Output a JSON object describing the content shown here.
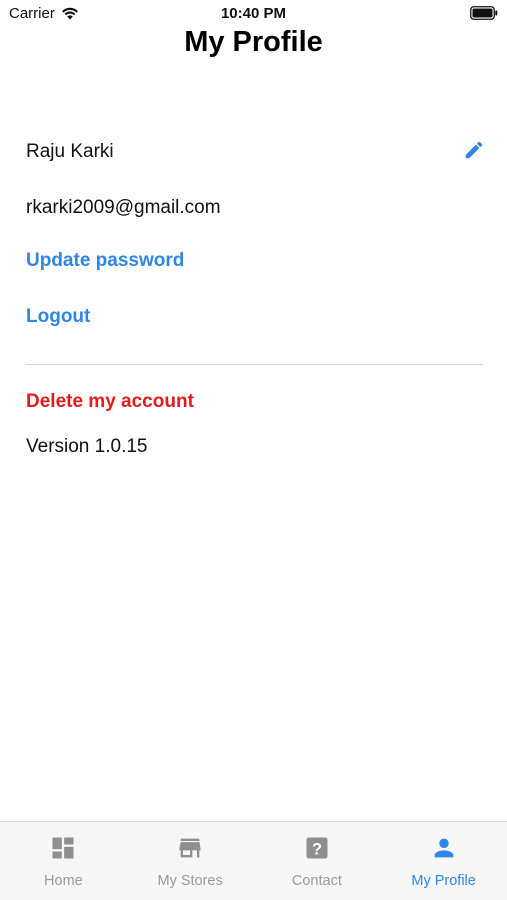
{
  "status_bar": {
    "carrier": "Carrier",
    "time": "10:40 PM"
  },
  "header": {
    "title": "My Profile"
  },
  "profile": {
    "name": "Raju Karki",
    "email": "rkarki2009@gmail.com",
    "update_password_label": "Update password",
    "logout_label": "Logout",
    "delete_account_label": "Delete my account",
    "version_text": "Version 1.0.15"
  },
  "tab_bar": {
    "tabs": [
      {
        "label": "Home",
        "icon": "dashboard-icon",
        "active": false
      },
      {
        "label": "My Stores",
        "icon": "store-icon",
        "active": false
      },
      {
        "label": "Contact",
        "icon": "help-icon",
        "active": false
      },
      {
        "label": "My Profile",
        "icon": "person-icon",
        "active": true
      }
    ]
  },
  "colors": {
    "accent": "#2e86e6",
    "danger": "#e31b1b",
    "inactive_tab": "#9a9a9a"
  }
}
